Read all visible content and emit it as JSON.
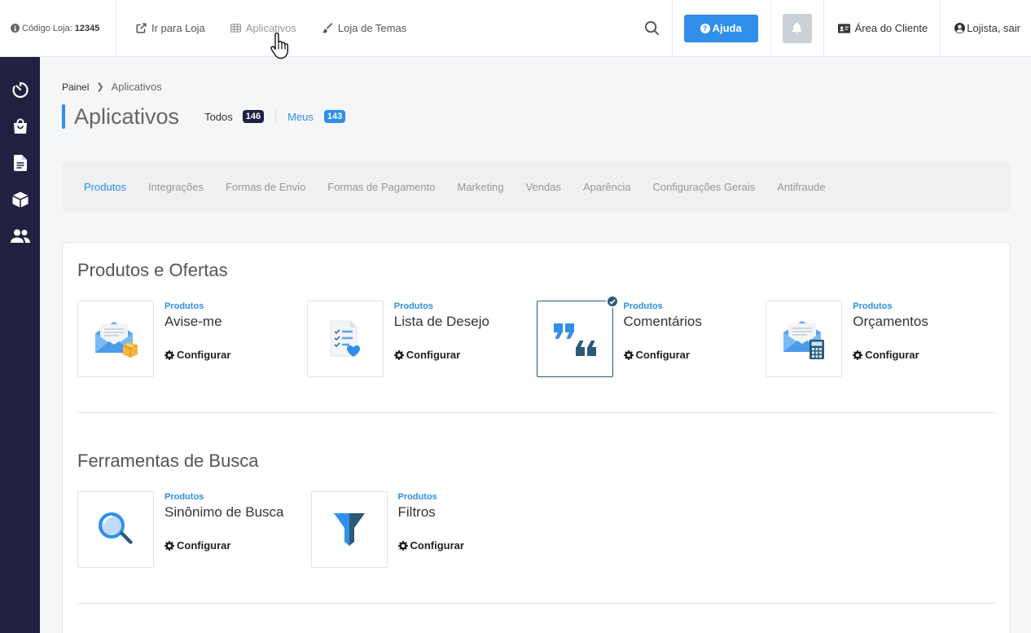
{
  "header": {
    "store_code_label": "Código Loja:",
    "store_code_value": "12345",
    "nav": [
      {
        "label": "Ir para Loja"
      },
      {
        "label": "Aplicativos"
      },
      {
        "label": "Loja de Temas"
      }
    ],
    "help_label": "Ajuda",
    "client_area_label": "Área do Cliente",
    "logout_label": "Lojista, sair"
  },
  "breadcrumb": {
    "root": "Painel",
    "current": "Aplicativos"
  },
  "page": {
    "title": "Aplicativos",
    "all_label": "Todos",
    "all_count": "146",
    "mine_label": "Meus",
    "mine_count": "143"
  },
  "categories": [
    "Produtos",
    "Integrações",
    "Formas de Envio",
    "Formas de Pagamento",
    "Marketing",
    "Vendas",
    "Aparência",
    "Configurações Gerais",
    "Antifraude"
  ],
  "sections": [
    {
      "title": "Produtos e Ofertas",
      "apps": [
        {
          "category": "Produtos",
          "name": "Avise-me",
          "action": "Configurar",
          "icon": "envelope-box-icon"
        },
        {
          "category": "Produtos",
          "name": "Lista de Desejo",
          "action": "Configurar",
          "icon": "wishlist-icon"
        },
        {
          "category": "Produtos",
          "name": "Comentários",
          "action": "Configurar",
          "icon": "quotes-icon",
          "installed": true
        },
        {
          "category": "Produtos",
          "name": "Orçamentos",
          "action": "Configurar",
          "icon": "envelope-calculator-icon"
        }
      ]
    },
    {
      "title": "Ferramentas de Busca",
      "apps": [
        {
          "category": "Produtos",
          "name": "Sinônimo de Busca",
          "action": "Configurar",
          "icon": "magnifier-icon"
        },
        {
          "category": "Produtos",
          "name": "Filtros",
          "action": "Configurar",
          "icon": "funnel-icon"
        }
      ]
    }
  ],
  "colors": {
    "accent": "#2f8fea",
    "sidebar": "#212041",
    "selected_border": "#2a5a77"
  }
}
